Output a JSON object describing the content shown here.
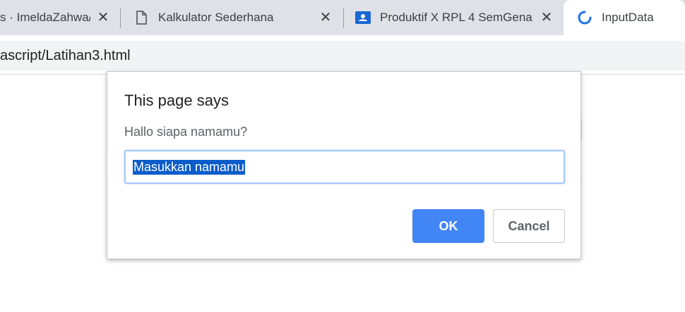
{
  "browser": {
    "tabs": [
      {
        "title": "s · ImeldaZahwa/",
        "icon": "none",
        "close_icon": "close-icon"
      },
      {
        "title": "Kalkulator Sederhana",
        "icon": "document-icon",
        "close_icon": "close-icon"
      },
      {
        "title": "Produktif X RPL 4 SemGena",
        "icon": "classroom-icon",
        "close_icon": "close-icon"
      },
      {
        "title": "InputData",
        "icon": "loading-spinner-icon",
        "active": true
      }
    ],
    "url": "ascript/Latihan3.html"
  },
  "dialog": {
    "title": "This page says",
    "message": "Hallo siapa namamu?",
    "input_value": "Masukkan namamu",
    "ok_label": "OK",
    "cancel_label": "Cancel"
  },
  "colors": {
    "tabstrip": "#dee1e6",
    "accent": "#4285f4",
    "selection": "#0a5cca",
    "spinner": "#1a73e8"
  }
}
